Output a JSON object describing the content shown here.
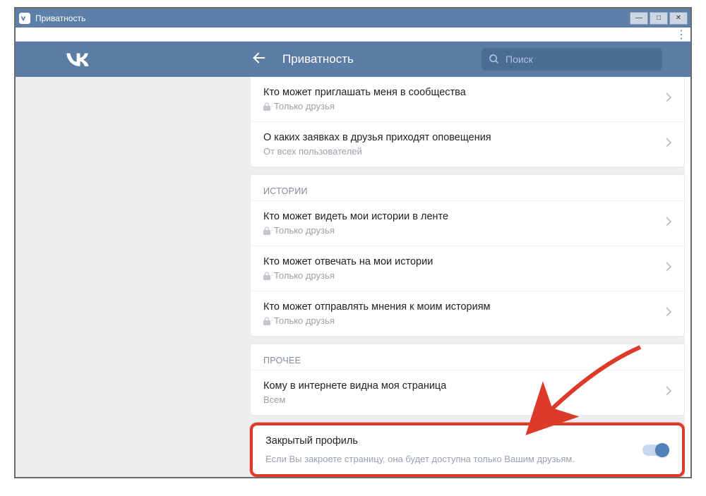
{
  "window": {
    "title": "Приватность"
  },
  "header": {
    "title": "Приватность",
    "search_placeholder": "Поиск"
  },
  "sections": [
    {
      "rows": [
        {
          "title": "Кто может приглашать меня в сообщества",
          "sub": "Только друзья",
          "locked": true
        },
        {
          "title": "О каких заявках в друзья приходят оповещения",
          "sub": "От всех пользователей",
          "locked": false
        }
      ]
    },
    {
      "heading": "ИСТОРИИ",
      "rows": [
        {
          "title": "Кто может видеть мои истории в ленте",
          "sub": "Только друзья",
          "locked": true
        },
        {
          "title": "Кто может отвечать на мои истории",
          "sub": "Только друзья",
          "locked": true
        },
        {
          "title": "Кто может отправлять мнения к моим историям",
          "sub": "Только друзья",
          "locked": true
        }
      ]
    },
    {
      "heading": "ПРОЧЕЕ",
      "rows": [
        {
          "title": "Кому в интернете видна моя страница",
          "sub": "Всем",
          "locked": false
        }
      ]
    },
    {
      "highlight": true,
      "rows": [
        {
          "title": "Закрытый профиль",
          "desc": "Если Вы закроете страницу, она будет доступна только Вашим друзьям.",
          "toggle": true
        }
      ]
    }
  ]
}
